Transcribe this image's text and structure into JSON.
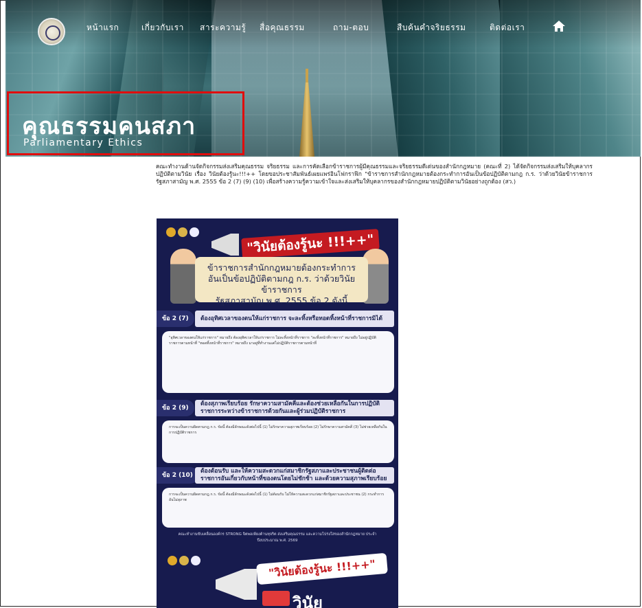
{
  "nav": {
    "items": [
      "หน้าแรก",
      "เกี่ยวกับเรา",
      "สาระความรู้",
      "สื่อคุณธรรม",
      "ถาม-ตอบ",
      "สืบค้นคำจริยธรรม",
      "ติดต่อเรา"
    ],
    "home_icon": "home-icon",
    "logo_icon": "parliament-seal-icon"
  },
  "hero": {
    "title_th": "คุณธรรมคนสภา",
    "title_en": "Parliamentary Ethics",
    "highlight_color": "#e10d0d"
  },
  "intro": {
    "text": "คณะทำงานด้านจัดกิจกรรมส่งเสริมคุณธรรม จริยธรรม และการคัดเลือกข้าราชการผู้มีคุณธรรมและจริยธรรมดีเด่นของสำนักกฎหมาย (คณะที่ 2) ได้จัดกิจกรรมส่งเสริมให้บุคลากรปฏิบัติตามวินัย เรื่อง วินัยต้องรู้นะ!!!++ โดยขอประชาสัมพันธ์เผยแพร่อินโฟกราฟิก \"ข้าราชการสำนักกฎหมายต้องกระทำการอันเป็นข้อปฏิบัติตามกฎ ก.ร. ว่าด้วยวินัยข้าราชการรัฐสภาสามัญ พ.ศ. 2555 ข้อ 2 (7) (9) (10) เพื่อสร้างความรู้ความเข้าใจและส่งเสริมให้บุคลากรของสำนักกฎหมายปฏิบัติตามวินัยอย่างถูกต้อง (สว.)"
  },
  "poster": {
    "banner": "\"วินัยต้องรู้นะ !!!++\"",
    "card_lines": [
      "ข้าราชการสำนักกฎหมายต้องกระทำการ",
      "อันเป็นข้อปฏิบัติตามกฎ ก.ร. ว่าด้วยวินัยข้าราชการ",
      "รัฐสภาสามัญ พ.ศ. 2555 ข้อ 2 ดังนี้"
    ],
    "sections": [
      {
        "num": "ข้อ 2 (7)",
        "head": "ต้องอุทิศเวลาของตนให้แก่ราชการ จะละทิ้งหรือทอดทิ้งหน้าที่ราชการมิได้",
        "body": "\"อุทิศเวลาของตนให้แก่ราชการ\" หมายถึง ต้องอุทิศเวลาให้แก่ราชการ ไม่ละทิ้งหน้าที่ราชการ \"ละทิ้งหน้าที่ราชการ\" หมายถึง ไม่อยู่ปฏิบัติราชการตามหน้าที่ \"ทอดทิ้งหน้าที่ราชการ\" หมายถึง มาอยู่ที่ทำงานแต่ไม่ปฏิบัติราชการตามหน้าที่"
      },
      {
        "num": "ข้อ 2 (9)",
        "head": "ต้องสุภาพเรียบร้อย รักษาความสามัคคีและต้องช่วยเหลือกันในการปฏิบัติราชการระหว่างข้าราชการด้วยกันและผู้ร่วมปฏิบัติราชการ",
        "body": "การจะเป็นความผิดตามกฎ ก.ร. ข้อนี้ ต้องมีลักษณะดังต่อไปนี้ (1) ไม่รักษาความสุภาพเรียบร้อย (2) ไม่รักษาความสามัคคี (3) ไม่ช่วยเหลือกันในการปฏิบัติราชการ"
      },
      {
        "num": "ข้อ 2 (10)",
        "head": "ต้องต้อนรับ และให้ความสะดวกแก่สมาชิกรัฐสภาและประชาชนผู้ติดต่อราชการอันเกี่ยวกับหน้าที่ของตนโดยไม่ชักช้า และด้วยความสุภาพเรียบร้อย",
        "body": "การจะเป็นความผิดตามกฎ ก.ร. ข้อนี้ ต้องมีลักษณะดังต่อไปนี้ (1) ไม่ต้อนรับ ไม่ให้ความสะดวกแก่สมาชิกรัฐสภาและประชาชน (2) กระทำการอันไม่สุภาพ"
      }
    ],
    "footer": "คณะทำงานขับเคลื่อนองค์กร STRONG จิตพอเพียงต้านทุจริต ส่งเสริมคุณธรรม และความโปร่งใสของสำนักกฎหมาย ประจำปีงบประมาณ พ.ศ. 2569",
    "banner2": "\"วินัยต้องรู้นะ !!!++\"",
    "bottom_text": "วินัย",
    "colors": {
      "navy": "#171b4e",
      "red": "#c41b21",
      "cream": "#f3e7c4"
    }
  }
}
